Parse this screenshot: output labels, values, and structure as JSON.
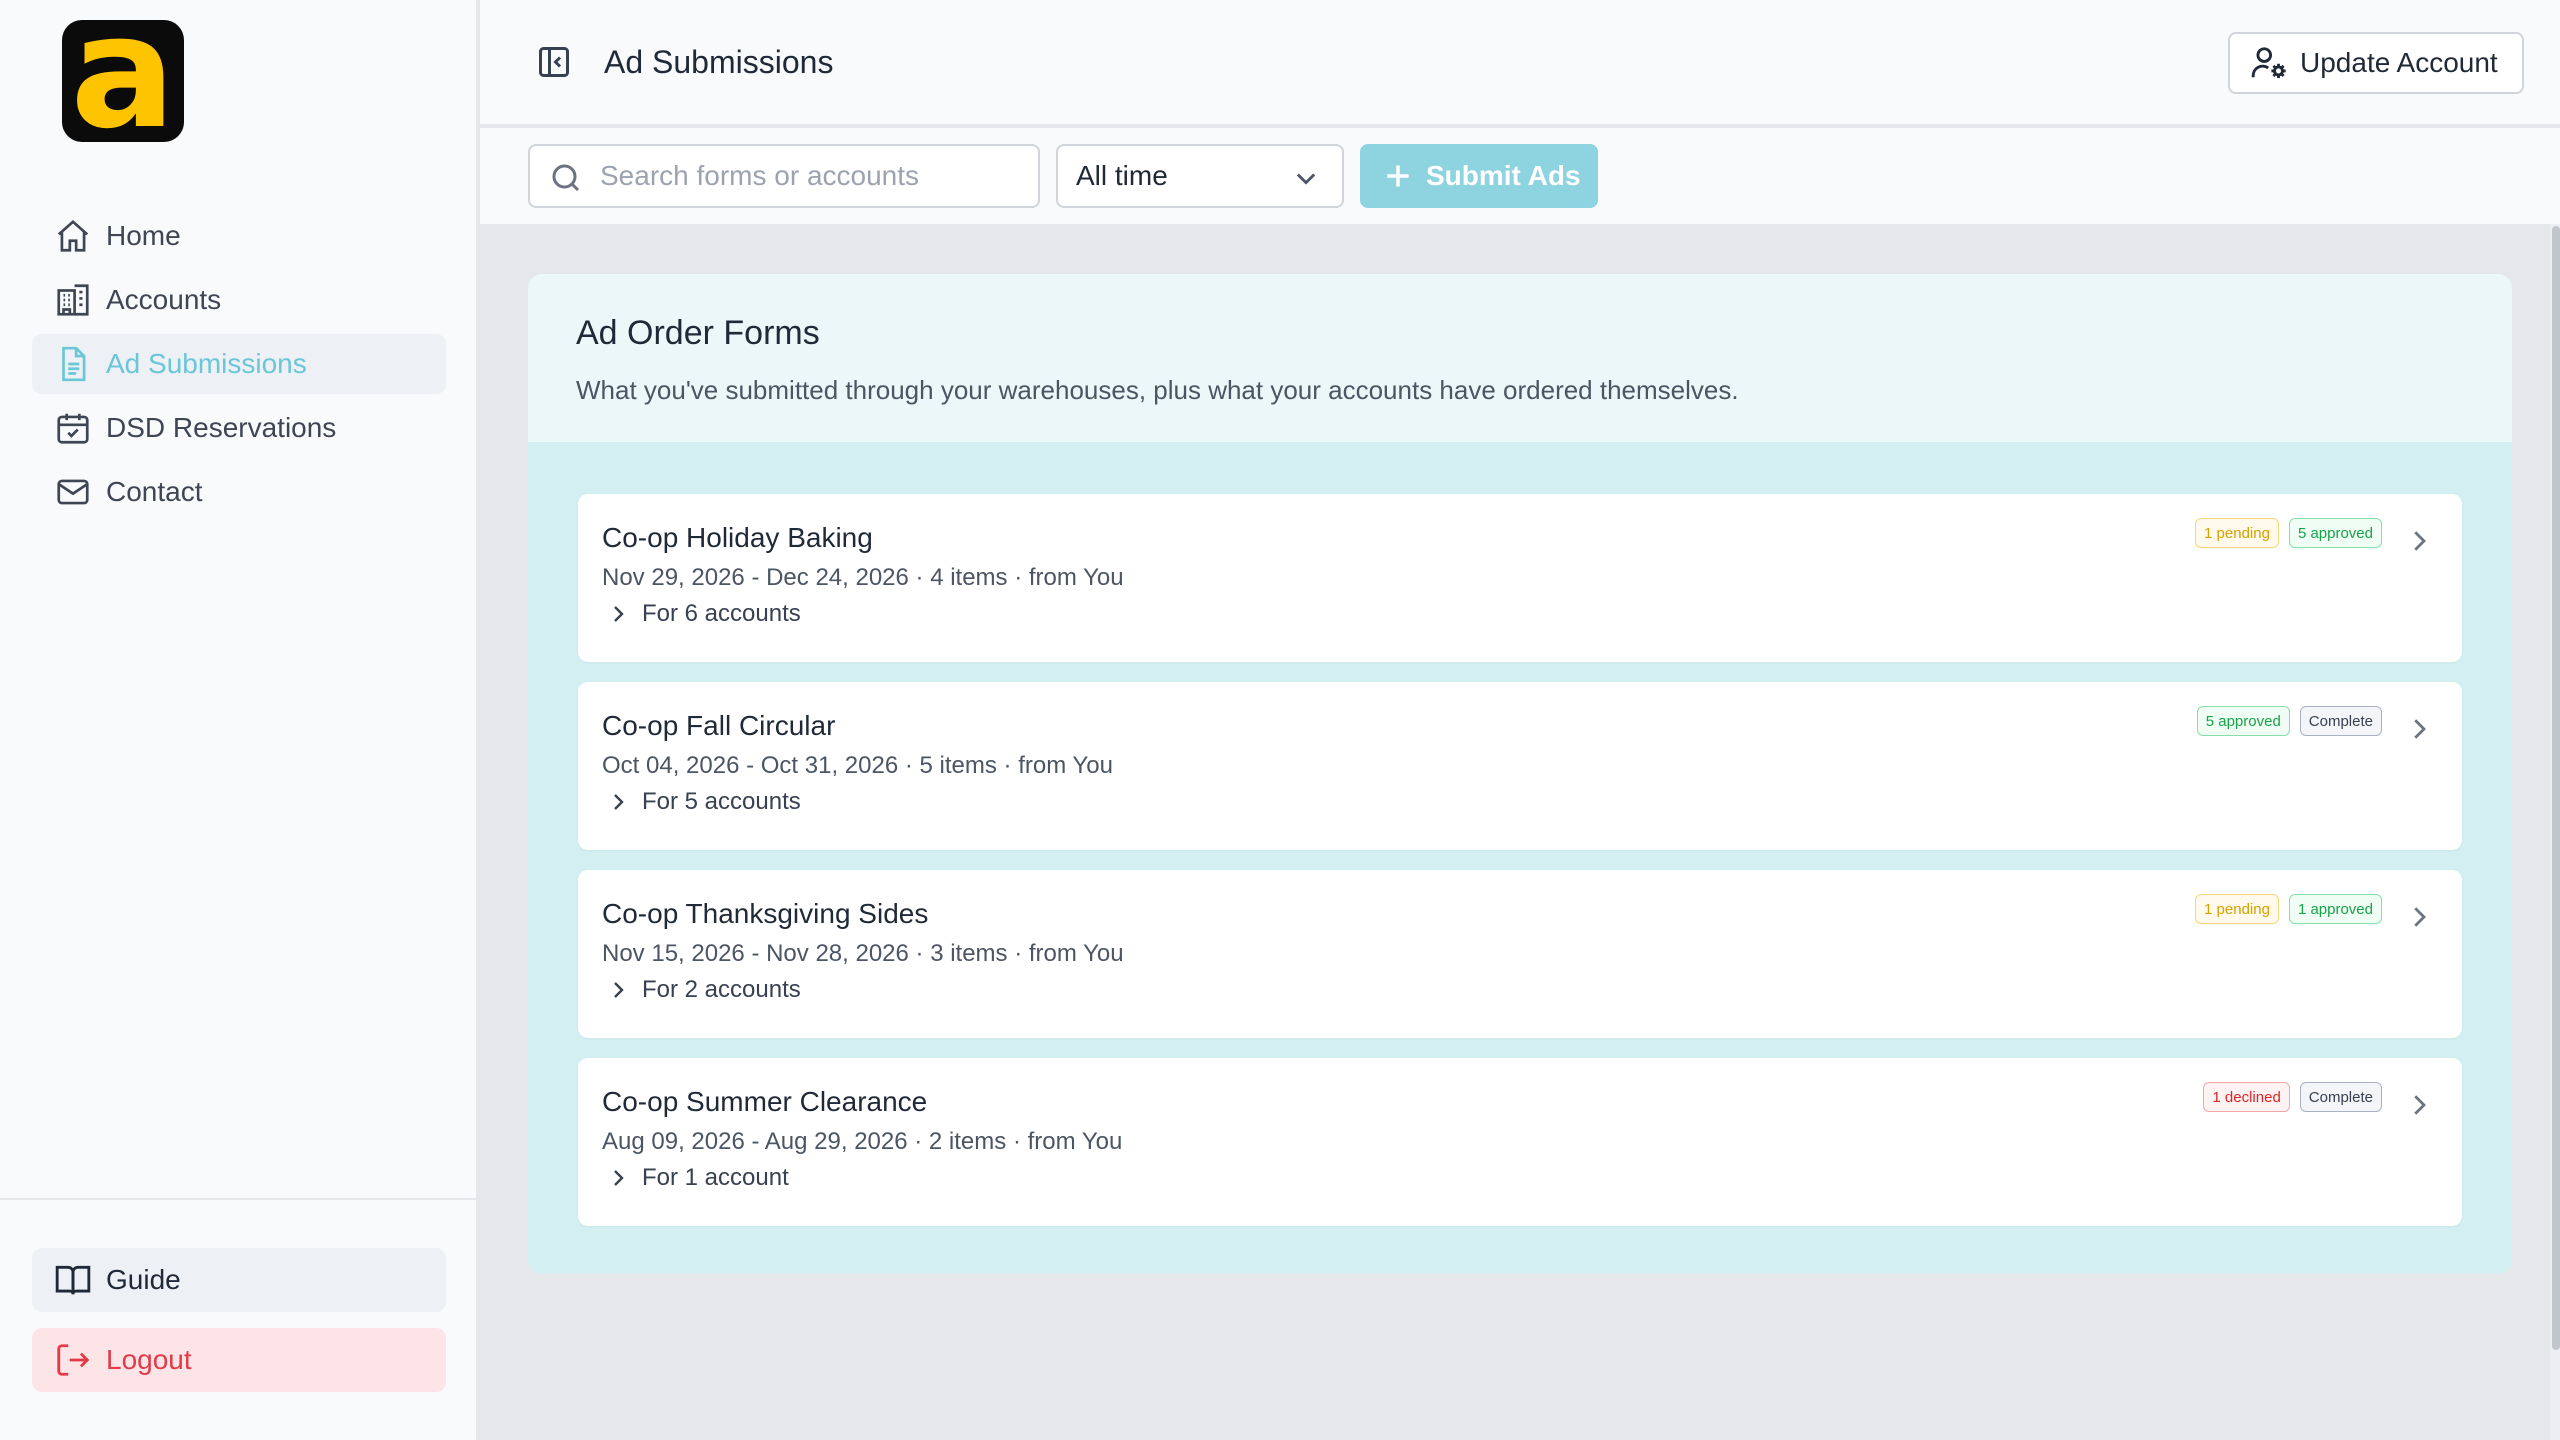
{
  "app": {
    "logo_letter": "a",
    "brand_color": "#ffc400",
    "accent_color": "#6bc6d8"
  },
  "sidebar": {
    "items": [
      {
        "label": "Home",
        "icon": "home-icon",
        "active": false
      },
      {
        "label": "Accounts",
        "icon": "building-icon",
        "active": false
      },
      {
        "label": "Ad Submissions",
        "icon": "document-icon",
        "active": true
      },
      {
        "label": "DSD Reservations",
        "icon": "calendar-check-icon",
        "active": false
      },
      {
        "label": "Contact",
        "icon": "mail-icon",
        "active": false
      }
    ],
    "guide_label": "Guide",
    "logout_label": "Logout"
  },
  "header": {
    "title": "Ad Submissions",
    "update_account_label": "Update Account"
  },
  "toolbar": {
    "search_placeholder": "Search forms or accounts",
    "time_filter": "All time",
    "submit_label": "Submit Ads"
  },
  "main": {
    "card_title": "Ad Order Forms",
    "card_subtitle": "What you've submitted through your warehouses, plus what your accounts have ordered themselves.",
    "forms": [
      {
        "title": "Co-op Holiday Baking",
        "meta": "Nov 29, 2026 - Dec 24, 2026 · 4 items · from You",
        "accounts": "For 6 accounts",
        "badges": [
          {
            "type": "pending",
            "text": "1 pending"
          },
          {
            "type": "approved",
            "text": "5 approved"
          }
        ]
      },
      {
        "title": "Co-op Fall Circular",
        "meta": "Oct 04, 2026 - Oct 31, 2026 · 5 items · from You",
        "accounts": "For 5 accounts",
        "badges": [
          {
            "type": "approved",
            "text": "5 approved"
          },
          {
            "type": "complete",
            "text": "Complete"
          }
        ]
      },
      {
        "title": "Co-op Thanksgiving Sides",
        "meta": "Nov 15, 2026 - Nov 28, 2026 · 3 items · from You",
        "accounts": "For 2 accounts",
        "badges": [
          {
            "type": "pending",
            "text": "1 pending"
          },
          {
            "type": "approved",
            "text": "1 approved"
          }
        ]
      },
      {
        "title": "Co-op Summer Clearance",
        "meta": "Aug 09, 2026 - Aug 29, 2026 · 2 items · from You",
        "accounts": "For 1 account",
        "badges": [
          {
            "type": "declined",
            "text": "1 declined"
          },
          {
            "type": "complete",
            "text": "Complete"
          }
        ]
      }
    ]
  }
}
